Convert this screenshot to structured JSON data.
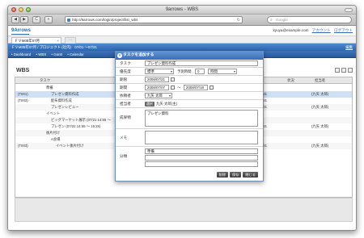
{
  "window": {
    "title": "9arrows - WBS"
  },
  "browser": {
    "url": "http://9arrows.com/login/project/list_wbs",
    "search_placeholder": "Google",
    "back": "◀",
    "forward": "▶",
    "reload": "C",
    "add": "+"
  },
  "app": {
    "logo": "9Arrows",
    "user_email": "kyuya@example.com",
    "account_link": "アカウント",
    "logout_link": "ログアウト",
    "project_tab": "ＦＶM08年07月",
    "new_tab": "⋯",
    "project_bar": "ＦＶM08年07月 / プロジェクト (社内)　07/01 〜07/31",
    "project_edit": "編集",
    "nav": [
      "• Dashboard",
      "• WBS",
      "• Gantt",
      "• Calendar"
    ]
  },
  "wbs": {
    "title": "WBS",
    "headers": [
      "タスク",
      "状況",
      "担当者"
    ],
    "rows": [
      {
        "id": "",
        "name": "準備",
        "date": "",
        "status": "",
        "owner": ""
      },
      {
        "id": "(T001)",
        "name": "プレゼン資料作成",
        "date": "/21",
        "status": "",
        "owner": "(九矢 太郎)"
      },
      {
        "id": "(T002)",
        "name": "配布資料作成",
        "date": "/21",
        "status": "",
        "owner": ""
      },
      {
        "id": "",
        "name": "プレゼンレビュー",
        "date": "/21",
        "status": "",
        "owner": "(九矢 太郎)"
      },
      {
        "id": "",
        "name": "イベント",
        "date": "",
        "status": "",
        "owner": ""
      },
      {
        "id": "",
        "name": "ビッグマーケット展示 (07/21 14:55 〜",
        "date": "",
        "status": "",
        "owner": ""
      },
      {
        "id": "",
        "name": "プレゼン (07/22 14:55 〜 15:25)",
        "date": "/21",
        "status": "",
        "owner": "(九矢 太郎)"
      },
      {
        "id": "",
        "name": "後片付け",
        "date": "",
        "status": "",
        "owner": ""
      },
      {
        "id": "",
        "name": "A会場",
        "date": "",
        "status": "",
        "owner": ""
      },
      {
        "id": "(T003)",
        "name": "イベント後片付け",
        "date": "/21",
        "status": "",
        "owner": "(九矢 太郎)"
      }
    ]
  },
  "modal": {
    "title": "タスクを追加する",
    "labels": {
      "task": "タスク",
      "priority": "優先度",
      "estimate": "予測時間",
      "deadline": "期限",
      "period": "期間",
      "requester": "依頼者",
      "assignee": "担当者",
      "deliverable": "成果物",
      "memo": "メモ",
      "category": "分類"
    },
    "values": {
      "task": "プレゼン資料作成",
      "priority": "標準",
      "estimate": "0",
      "estimate_unit": "時間",
      "deadline": "2008/07/21",
      "period_start": "2008/07/07",
      "period_sep": "〜",
      "period_end": "2008/07/18",
      "requester": "九矢 太郎",
      "assignee_chip": "選択",
      "assignee": "九矢 太郎(主)",
      "deliverable": "プレゼン資料",
      "memo": "",
      "category": "準備"
    },
    "buttons": [
      "削除",
      "保存",
      "閉じる"
    ]
  }
}
